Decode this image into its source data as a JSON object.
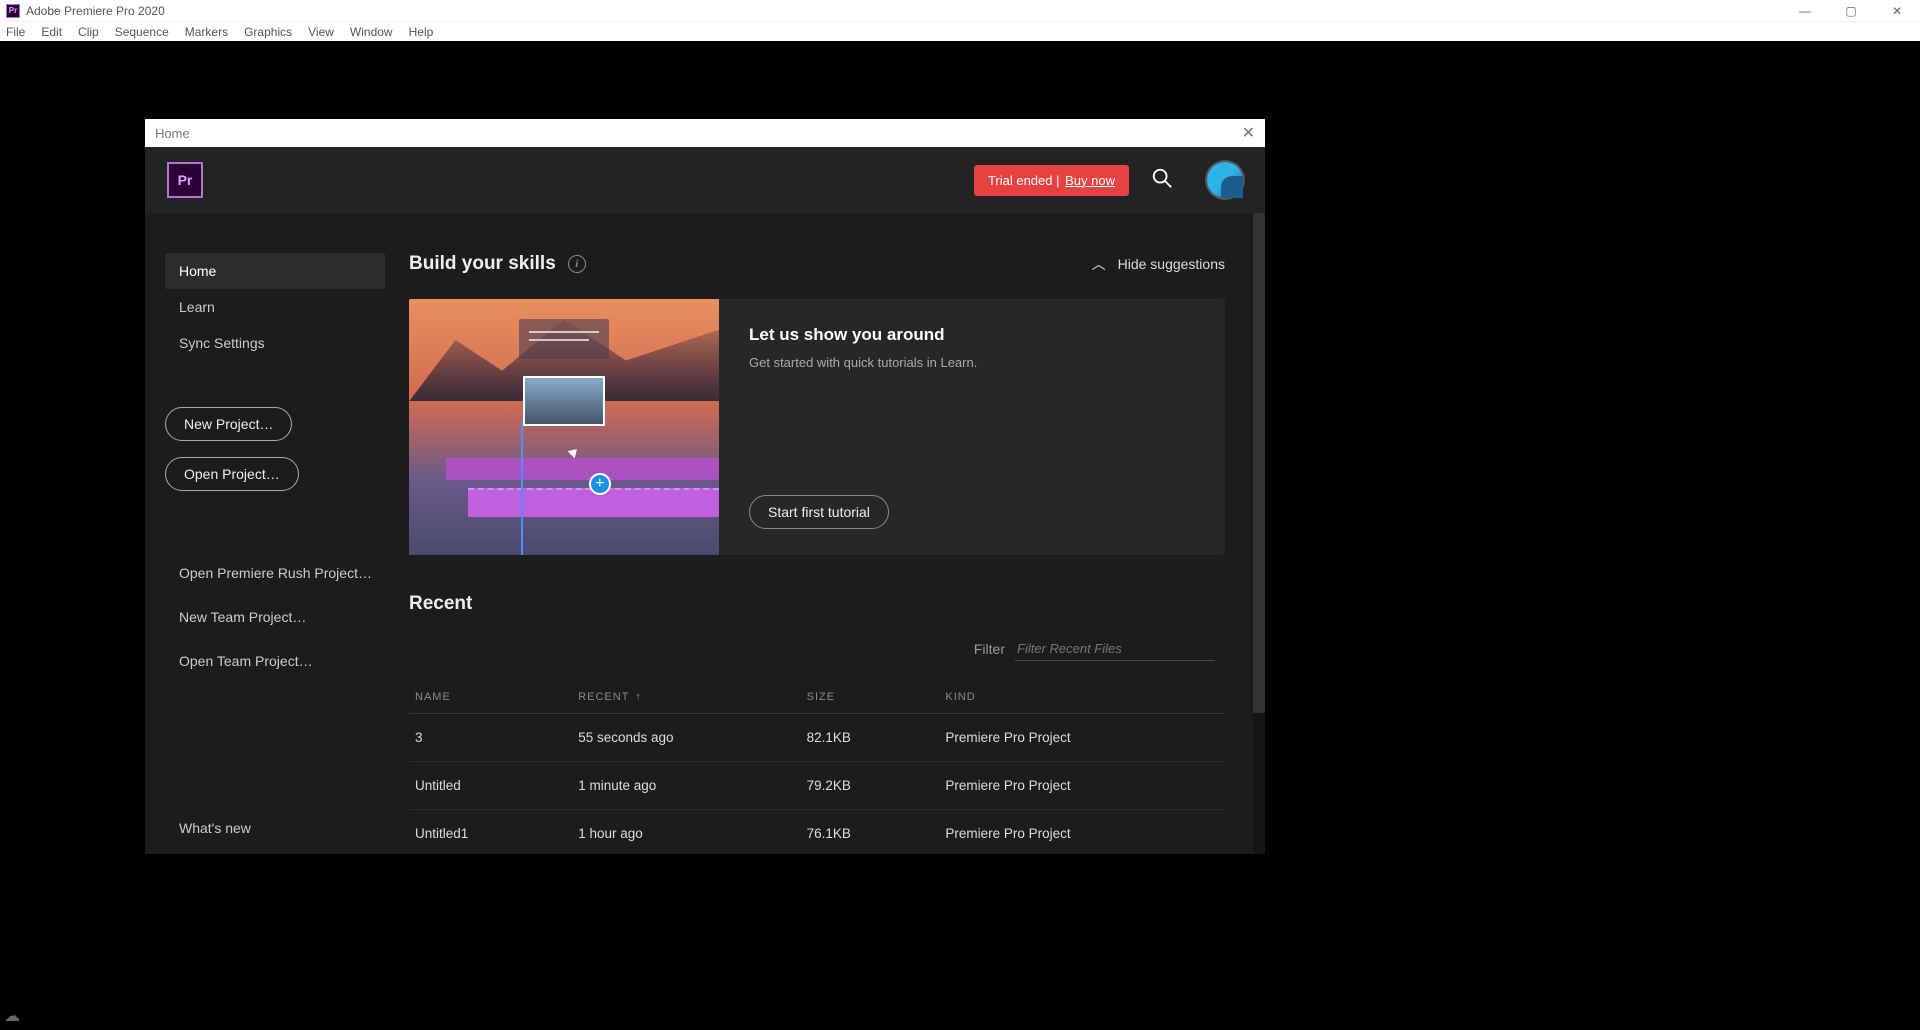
{
  "titlebar": {
    "app": "Adobe Premiere Pro 2020"
  },
  "menubar": [
    "File",
    "Edit",
    "Clip",
    "Sequence",
    "Markers",
    "Graphics",
    "View",
    "Window",
    "Help"
  ],
  "home": {
    "panel_title": "Home",
    "header": {
      "logo": "Pr",
      "trial_text": "Trial ended",
      "buy_now": "Buy now"
    },
    "sidebar": {
      "nav": [
        "Home",
        "Learn",
        "Sync Settings"
      ],
      "new_project": "New Project…",
      "open_project": "Open Project…",
      "links": [
        "Open Premiere Rush Project…",
        "New Team Project…",
        "Open Team Project…"
      ],
      "whats_new": "What's new"
    },
    "skills": {
      "section": "Build your skills",
      "hide": "Hide suggestions",
      "card_title": "Let us show you around",
      "card_sub": "Get started with quick tutorials in Learn.",
      "start": "Start first tutorial"
    },
    "recent": {
      "title": "Recent",
      "filter_label": "Filter",
      "filter_placeholder": "Filter Recent Files",
      "columns": [
        "NAME",
        "RECENT",
        "SIZE",
        "KIND"
      ],
      "rows": [
        {
          "name": "3",
          "recent": "55 seconds ago",
          "size": "82.1KB",
          "kind": "Premiere Pro Project"
        },
        {
          "name": "Untitled",
          "recent": "1 minute ago",
          "size": "79.2KB",
          "kind": "Premiere Pro Project"
        },
        {
          "name": "Untitled1",
          "recent": "1 hour ago",
          "size": "76.1KB",
          "kind": "Premiere Pro Project"
        }
      ]
    }
  }
}
